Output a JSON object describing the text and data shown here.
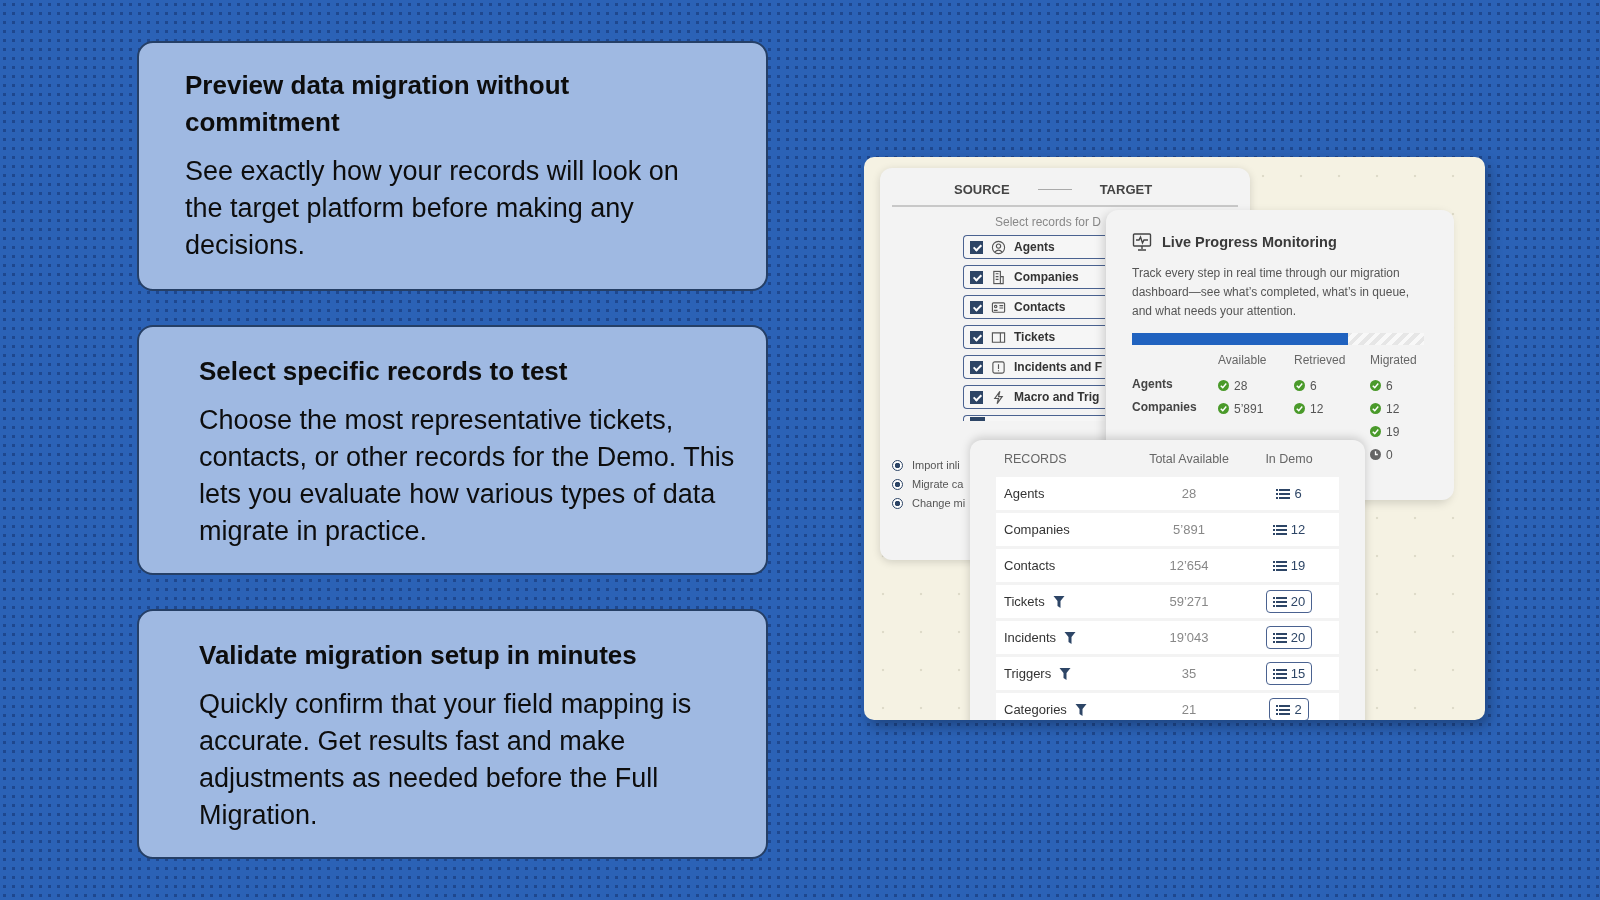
{
  "features": [
    {
      "title": "Preview data migration without commitment",
      "body": "See exactly how your records will look on the target platform before making any decisions."
    },
    {
      "title": "Select specific records to test",
      "body": "Choose the most representative tickets, contacts, or other records for the Demo. This lets you evaluate how various types of data migrate in practice."
    },
    {
      "title": "Validate migration setup in minutes",
      "body": "Quickly confirm that your field mapping is accurate. Get results fast and make adjustments as needed before the Full Migration."
    }
  ],
  "source_panel": {
    "steps": [
      "SOURCE",
      "TARGET"
    ],
    "hint": "Select records for D",
    "record_types": [
      {
        "label": "Agents",
        "checked": true,
        "kind": "person"
      },
      {
        "label": "Companies",
        "checked": true,
        "kind": "building"
      },
      {
        "label": "Contacts",
        "checked": true,
        "kind": "card"
      },
      {
        "label": "Tickets",
        "checked": true,
        "kind": "ticket"
      },
      {
        "label": "Incidents and F",
        "checked": true,
        "kind": "alert"
      },
      {
        "label": "Macro and Trig",
        "checked": true,
        "kind": "bolt"
      },
      {
        "checked": true,
        "kind": "partial"
      }
    ],
    "options": [
      {
        "label": "Import inli",
        "selected": true
      },
      {
        "label": "Migrate ca",
        "selected": true
      },
      {
        "label": "Change mi",
        "selected": true
      }
    ]
  },
  "monitoring": {
    "title": "Live Progress Monitoring",
    "text": "Track every step in real time through our migration dashboard—see what’s completed, what’s in queue, and what needs your attention.",
    "level": 0.74,
    "columns": [
      "Available",
      "Retrieved",
      "Migrated"
    ],
    "rows": [
      {
        "label": "Agents",
        "available": "28",
        "retrieved": "6",
        "migrated": "6",
        "pending": false
      },
      {
        "label": "Companies",
        "available": "5’891",
        "retrieved": "12",
        "migrated": "12",
        "pending": false
      },
      {
        "migrated": "19",
        "pending": false
      },
      {
        "migrated": "0",
        "pending": true
      }
    ]
  },
  "records": {
    "columns": [
      "RECORDS",
      "Total Available",
      "In Demo"
    ],
    "rows": [
      {
        "name": "Agents",
        "total": "28",
        "demo": "6",
        "filtered": false
      },
      {
        "name": "Companies",
        "total": "5’891",
        "demo": "12",
        "filtered": false
      },
      {
        "name": "Contacts",
        "total": "12’654",
        "demo": "19",
        "filtered": false
      },
      {
        "name": "Tickets",
        "total": "59’271",
        "demo": "20",
        "filtered": true
      },
      {
        "name": "Incidents",
        "total": "19’043",
        "demo": "20",
        "filtered": true
      },
      {
        "name": "Triggers",
        "total": "35",
        "demo": "15",
        "filtered": true
      },
      {
        "name": "Categories",
        "total": "21",
        "demo": "2",
        "filtered": true
      }
    ]
  }
}
